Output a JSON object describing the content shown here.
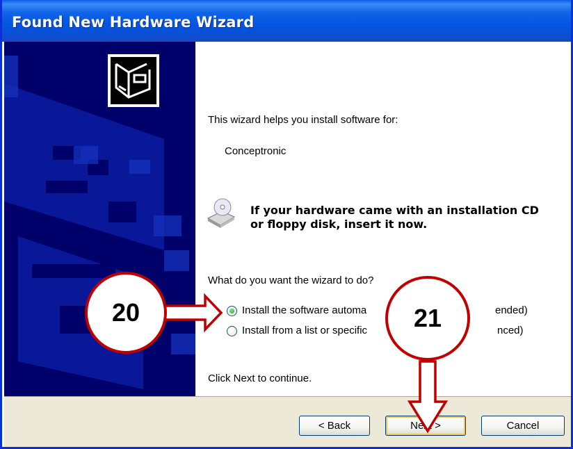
{
  "window": {
    "title": "Found New Hardware Wizard"
  },
  "content": {
    "intro": "This wizard helps you install software for:",
    "device": "Conceptronic",
    "cd_notice_line1": "If your hardware came with an installation CD",
    "cd_notice_line2": "or floppy disk, insert it now.",
    "question": "What do you want the wizard to do?",
    "options": [
      {
        "label": "Install the software automa",
        "label_end": "ended)",
        "selected": true
      },
      {
        "label": "Install from a list or specific",
        "label_end": "nced)",
        "selected": false
      }
    ],
    "footer": "Click Next to continue."
  },
  "buttons": {
    "back": "< Back",
    "next": "Next >",
    "cancel": "Cancel"
  },
  "callouts": [
    {
      "label": "20"
    },
    {
      "label": "21"
    }
  ],
  "colors": {
    "sidebar": "#00006b",
    "accent": "#c00000",
    "title_bar": "#0554e0",
    "button_bar": "#ece9d8"
  }
}
